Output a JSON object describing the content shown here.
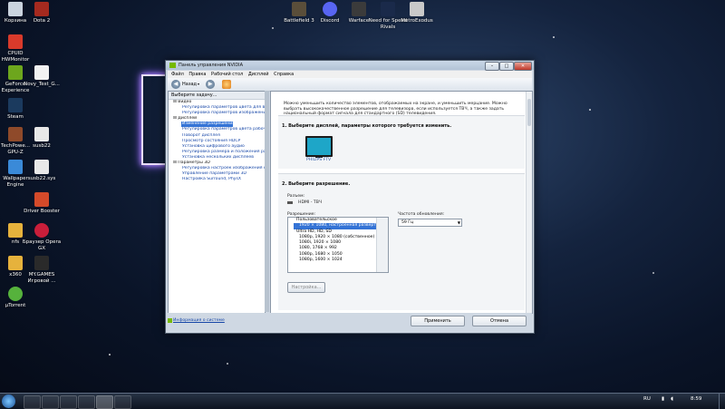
{
  "desktop": {
    "icons": [
      {
        "label": "Корзина",
        "color": "#c9d3de"
      },
      {
        "label": "Dota 2",
        "color": "#a52a1f"
      },
      {
        "label": "CPUID HWMonitor",
        "color": "#d93a2b"
      },
      {
        "label": "GeForce Experience",
        "color": "#6da61d"
      },
      {
        "label": "Novy_Test_G...",
        "color": "#f2f2f2"
      },
      {
        "label": "Steam",
        "color": "#1b3a5e"
      },
      {
        "label": "TechPowe... GPU-Z",
        "color": "#8f4a2a"
      },
      {
        "label": "susb22",
        "color": "#e8e8e8"
      },
      {
        "label": "Wallpaper Engine",
        "color": "#3a8ad8"
      },
      {
        "label": "susb22.sys",
        "color": "#e8e8e8"
      },
      {
        "label": "Driver Booster",
        "color": "#d44a2a"
      },
      {
        "label": "nfs",
        "color": "#e6b23c"
      },
      {
        "label": "Браузер Opera GX",
        "color": "#c91e3a"
      },
      {
        "label": "x360",
        "color": "#e6b23c"
      },
      {
        "label": "MY.GAMES Игровой ...",
        "color": "#2a2a2a"
      },
      {
        "label": "µTorrent",
        "color": "#56b23c"
      },
      {
        "label": "Battlefield 3",
        "color": "#5a4e3a"
      },
      {
        "label": "Discord",
        "color": "#5865f2"
      },
      {
        "label": "Warface",
        "color": "#3b3b3b"
      },
      {
        "label": "Need for Speed Rivals",
        "color": "#1a2a4a"
      },
      {
        "label": "MetroExodus",
        "color": "#c9c9c9"
      }
    ]
  },
  "window": {
    "title": "Панель управления NVIDIA",
    "controls": {
      "minimize": "–",
      "maximize": "□",
      "close": "✕"
    },
    "menu": [
      "Файл",
      "Правка",
      "Рабочий стол",
      "Дисплей",
      "Справка"
    ],
    "toolbar": {
      "back_label": "Назад",
      "back_icon": "back-arrow-icon",
      "forward_icon": "forward-arrow-icon",
      "home_icon": "home-icon"
    },
    "left_panel": {
      "header": "Выберите задачу...",
      "tree": [
        {
          "type": "cat",
          "label": "⊟ Видео"
        },
        {
          "type": "item",
          "label": "Регулировка параметров цвета для видео"
        },
        {
          "type": "item",
          "label": "Регулировка параметров изображения для видео"
        },
        {
          "type": "cat",
          "label": "⊟ Дисплей"
        },
        {
          "type": "sel",
          "label": "Изменение разрешения"
        },
        {
          "type": "item",
          "label": "Регулировка параметров цвета рабочего стола"
        },
        {
          "type": "item",
          "label": "Поворот дисплея"
        },
        {
          "type": "item",
          "label": "Просмотр состояния HDCP"
        },
        {
          "type": "item",
          "label": "Установка цифрового аудио"
        },
        {
          "type": "item",
          "label": "Регулировка размера и положения рабочего стола"
        },
        {
          "type": "item",
          "label": "Установка нескольких дисплеев"
        },
        {
          "type": "cat",
          "label": "⊟ Параметры 3D"
        },
        {
          "type": "item",
          "label": "Регулировка настроек изображения с просмотром"
        },
        {
          "type": "item",
          "label": "Управление параметрами 3D"
        },
        {
          "type": "item",
          "label": "Настройка Surround, PhysX"
        }
      ]
    },
    "content": {
      "intro": "Можно уменьшить количество элементов, отображаемых на экране, и уменьшить мерцание. Можно выбрать высококачественное разрешение для телевизора, если используется ТВЧ, а также задать национальный формат сигнала для стандартного (SD) телевидения.",
      "step1_title": "1. Выберите дисплей, параметры которого требуется изменить.",
      "display_name": "PHILIPS FTV",
      "step2_title": "2. Выберите разрешение.",
      "connector_label": "Разъем:",
      "connector_value": "HDMI - ТВЧ",
      "resolution_label": "Разрешение:",
      "resolutions": [
        {
          "type": "cat",
          "label": "Пользовательское"
        },
        {
          "type": "picked",
          "label": "1920 × 1080, настроенная развертка"
        },
        {
          "type": "cat",
          "label": "Ultra HD, HD, SD"
        },
        {
          "type": "item",
          "label": "1080p, 1920 × 1080 (собственное)"
        },
        {
          "type": "item",
          "label": "1080i, 1920 × 1080"
        },
        {
          "type": "item",
          "label": "1080, 1768 × 992"
        },
        {
          "type": "item",
          "label": "1080p, 1680 × 1050"
        },
        {
          "type": "item",
          "label": "1080p, 1600 × 1024"
        }
      ],
      "refresh_label": "Частота обновления:",
      "refresh_value": "59 Гц",
      "customize_button": "Настройка..."
    },
    "bottom": {
      "sysinfo_link": "Информация о системе",
      "apply_button": "Применить",
      "cancel_button": "Отмена"
    }
  },
  "taskbar": {
    "lang": "RU",
    "time": "8:59"
  }
}
